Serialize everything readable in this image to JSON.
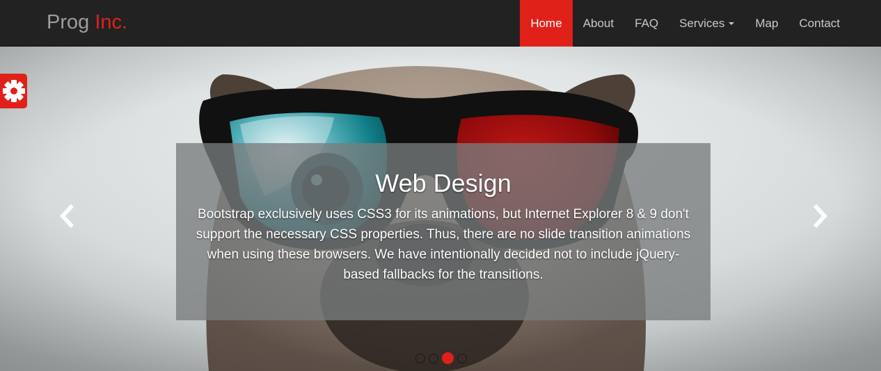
{
  "brand": {
    "prefix": "Prog",
    "accent": "Inc."
  },
  "nav": {
    "items": [
      {
        "label": "Home",
        "active": true
      },
      {
        "label": "About"
      },
      {
        "label": "FAQ"
      },
      {
        "label": "Services",
        "dropdown": true
      },
      {
        "label": "Map"
      },
      {
        "label": "Contact"
      }
    ]
  },
  "carousel": {
    "title": "Web Design",
    "text": "Bootstrap exclusively uses CSS3 for its animations, but Internet Explorer 8 & 9 don't support the necessary CSS properties. Thus, there are no slide transition animations when using these browsers. We have intentionally decided not to include jQuery-based fallbacks for the transitions.",
    "slide_count": 4,
    "active_slide": 3,
    "prev_icon": "chevron-left-icon",
    "next_icon": "chevron-right-icon"
  },
  "settings": {
    "icon": "gear-icon"
  },
  "colors": {
    "accent": "#e0211a",
    "navbar": "#222222",
    "nav_text": "#c9c9c9"
  }
}
